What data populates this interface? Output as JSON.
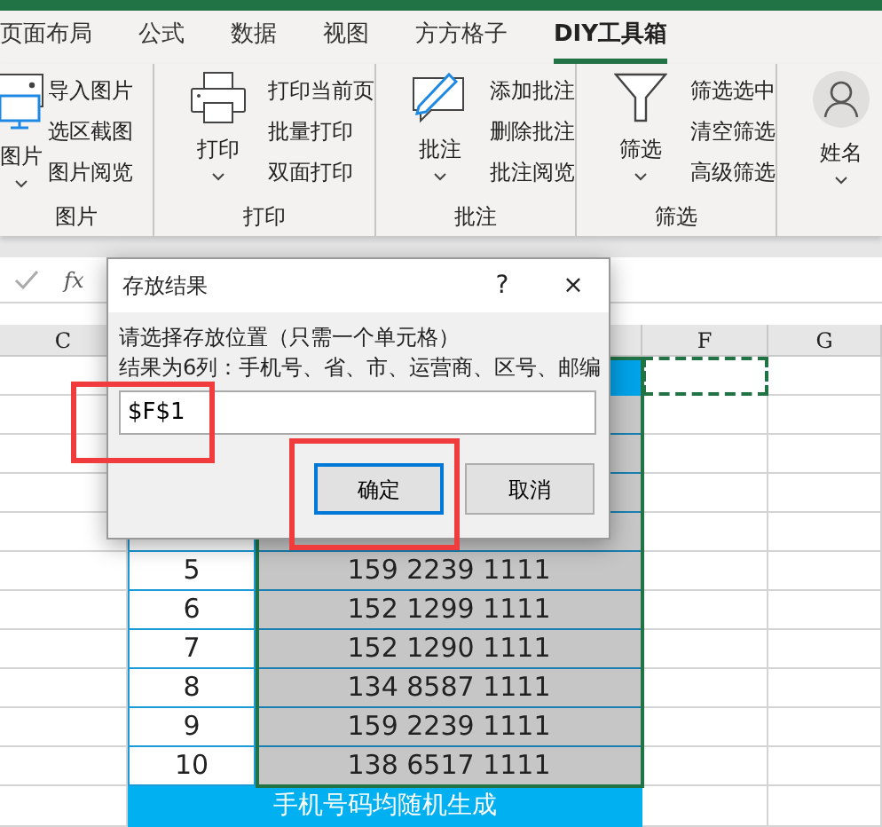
{
  "tabs": [
    {
      "label": "页面布局",
      "selected": false
    },
    {
      "label": "公式",
      "selected": false
    },
    {
      "label": "数据",
      "selected": false
    },
    {
      "label": "视图",
      "selected": false
    },
    {
      "label": "方方格子",
      "selected": false
    },
    {
      "label": "DIY工具箱",
      "selected": true
    }
  ],
  "ribbon_groups": [
    {
      "label": "图片",
      "kind": "picture",
      "big_button": "图片",
      "items": [
        "导入图片",
        "选区截图",
        "图片阅览"
      ]
    },
    {
      "label": "打印",
      "kind": "printer",
      "big_button": "打印",
      "items": [
        "打印当前页",
        "批量打印",
        "双面打印"
      ]
    },
    {
      "label": "批注",
      "kind": "comment",
      "big_button": "批注",
      "items": [
        "添加批注",
        "删除批注",
        "批注阅览"
      ]
    },
    {
      "label": "筛选",
      "kind": "filter",
      "big_button": "筛选",
      "items": [
        "筛选选中",
        "清空筛选",
        "高级筛选"
      ]
    },
    {
      "kind": "person",
      "big_button": "姓名"
    }
  ],
  "formula_bar": {
    "function_label": "fx"
  },
  "column_headers": [
    "C",
    "F",
    "G"
  ],
  "rows": [
    {
      "number": "5",
      "phone": "159 2239 1111"
    },
    {
      "number": "6",
      "phone": "152 1299 1111"
    },
    {
      "number": "7",
      "phone": "152 1290 1111"
    },
    {
      "number": "8",
      "phone": "134 8587 1111"
    },
    {
      "number": "9",
      "phone": "159 2239 1111"
    },
    {
      "number": "10",
      "phone": "138 6517 1111"
    }
  ],
  "footer": "手机号码均随机生成",
  "dialog": {
    "title": "存放结果",
    "help": "?",
    "close": "×",
    "lines": [
      "请选择存放位置（只需一个单元格）",
      "结果为6列：手机号、省、市、运营商、区号、邮编"
    ],
    "input_value": "$F$1",
    "buttons": [
      {
        "label": "确定",
        "focused": true
      },
      {
        "label": "取消",
        "focused": false
      }
    ]
  }
}
